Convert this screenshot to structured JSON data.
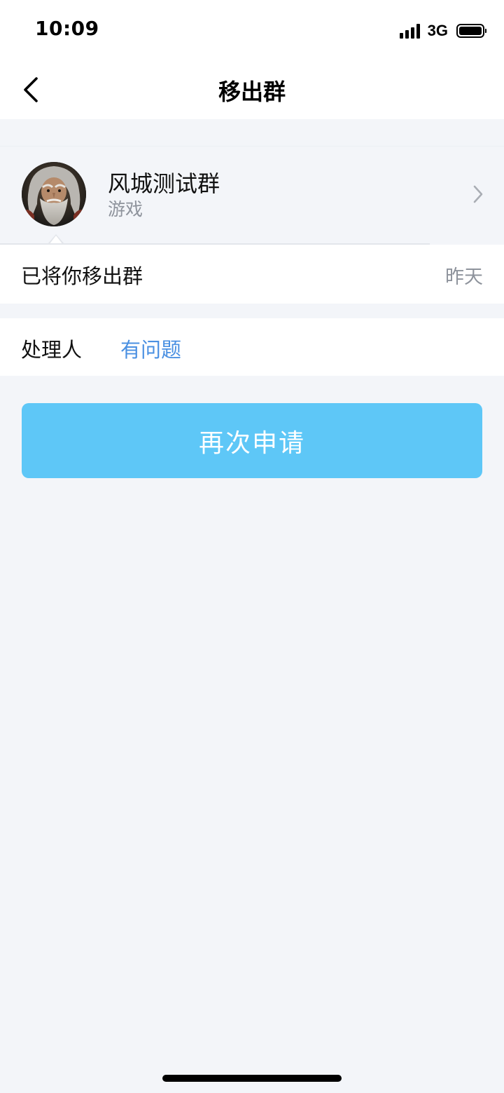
{
  "status_bar": {
    "time": "10:09",
    "network": "3G",
    "icons": [
      "signal-icon",
      "battery-icon"
    ]
  },
  "nav": {
    "title": "移出群",
    "back_icon": "chevron-left-icon"
  },
  "group": {
    "name": "风城测试群",
    "category": "游戏",
    "avatar_icon": "avatar-old-wizard",
    "chevron_icon": "chevron-right-icon"
  },
  "message": {
    "text": "已将你移出群",
    "time": "昨天"
  },
  "handler": {
    "label": "处理人",
    "link": "有问题"
  },
  "actions": {
    "reapply_label": "再次申请"
  },
  "colors": {
    "accent_button": "#5ec7f7",
    "link": "#4a90e2",
    "secondary_text": "#8e939c",
    "page_background": "#f3f5f9"
  }
}
